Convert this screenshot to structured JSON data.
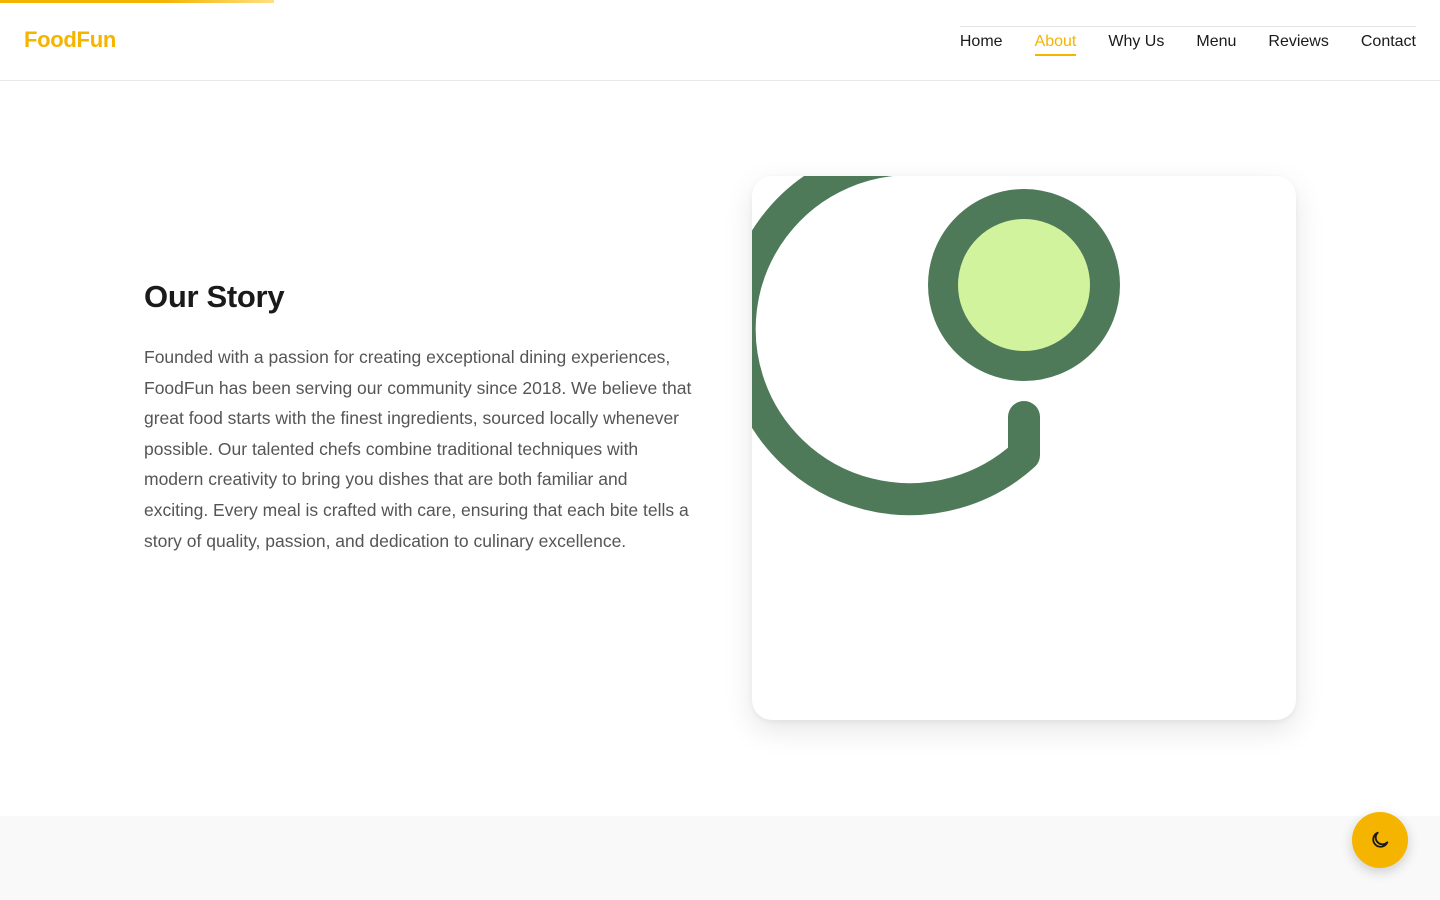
{
  "brand": {
    "name": "FoodFun",
    "accent": "#f5b400"
  },
  "scroll_progress": 0.19,
  "nav": {
    "items": [
      {
        "label": "Home",
        "active": false
      },
      {
        "label": "About",
        "active": true
      },
      {
        "label": "Why Us",
        "active": false
      },
      {
        "label": "Menu",
        "active": false
      },
      {
        "label": "Reviews",
        "active": false
      },
      {
        "label": "Contact",
        "active": false
      }
    ]
  },
  "story": {
    "title": "Our Story",
    "body": "Founded with a passion for creating exceptional dining experiences, FoodFun has been serving our community since 2018. We believe that great food starts with the finest ingredients, sourced locally whenever possible. Our talented chefs combine traditional techniques with modern creativity to bring you dishes that are both familiar and exciting. Every meal is crafted with care, ensuring that each bite tells a story of quality, passion, and dedication to culinary excellence.",
    "image": {
      "icon": "loading-spinner-icon",
      "colors": {
        "ring": "#4f7a5a",
        "center": "#d2f39d"
      }
    }
  },
  "theme_toggle": {
    "icon": "moon-icon"
  }
}
